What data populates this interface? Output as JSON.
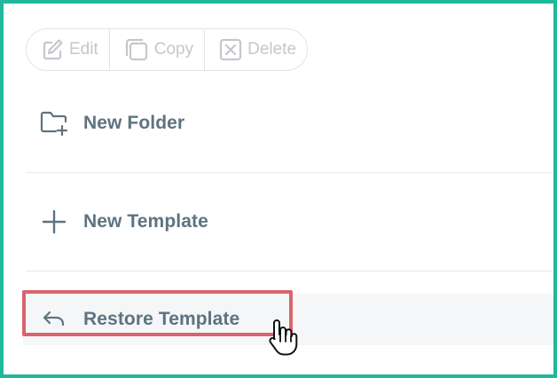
{
  "toolbar": {
    "edit_label": "Edit",
    "copy_label": "Copy",
    "delete_label": "Delete"
  },
  "actions": [
    {
      "label": "New Folder",
      "icon": "folder-plus-icon"
    },
    {
      "label": "New Template",
      "icon": "plus-icon"
    },
    {
      "label": "Restore Template",
      "icon": "undo-arrow-icon"
    }
  ],
  "colors": {
    "frame_border": "#1fb89a",
    "highlight_border": "#d9646c",
    "label_text": "#5d7381",
    "disabled_text": "#c3c8cd"
  }
}
